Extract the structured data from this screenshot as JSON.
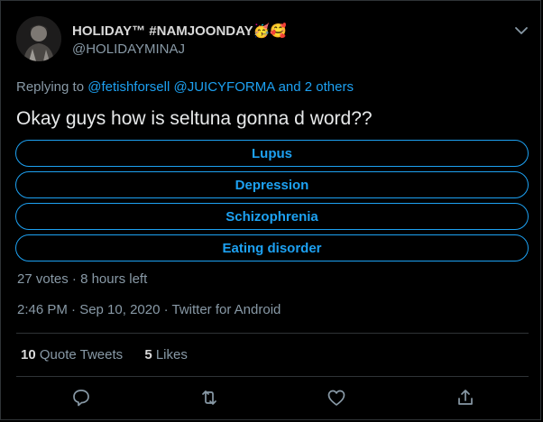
{
  "tweet": {
    "display_name": "HOLIDAY™ #NAMJOONDAY🥳🥰",
    "handle": "@HOLIDAYMINAJ",
    "replying_prefix": "Replying to",
    "replying_mentions": "@fetishforsell @JUICYFORMA",
    "replying_and": "and",
    "replying_others": "2 others",
    "text": "Okay guys how is seltuna gonna d word??",
    "poll": {
      "options": [
        "Lupus",
        "Depression",
        "Schizophrenia",
        "Eating disorder"
      ],
      "votes": "27 votes",
      "separator": "·",
      "time_left": "8 hours left"
    },
    "timestamp": "2:46 PM · Sep 10, 2020 · Twitter for Android",
    "stats": {
      "quote_tweets_count": "10",
      "quote_tweets_label": "Quote Tweets",
      "likes_count": "5",
      "likes_label": "Likes"
    }
  },
  "icons": {
    "menu": "chevron-down-icon",
    "reply": "reply-icon",
    "retweet": "retweet-icon",
    "like": "heart-icon",
    "share": "share-icon"
  },
  "colors": {
    "background": "#000000",
    "accent": "#1da1f2",
    "text": "#d9d9d9",
    "secondary": "#8899a6",
    "border": "#2f3336"
  }
}
